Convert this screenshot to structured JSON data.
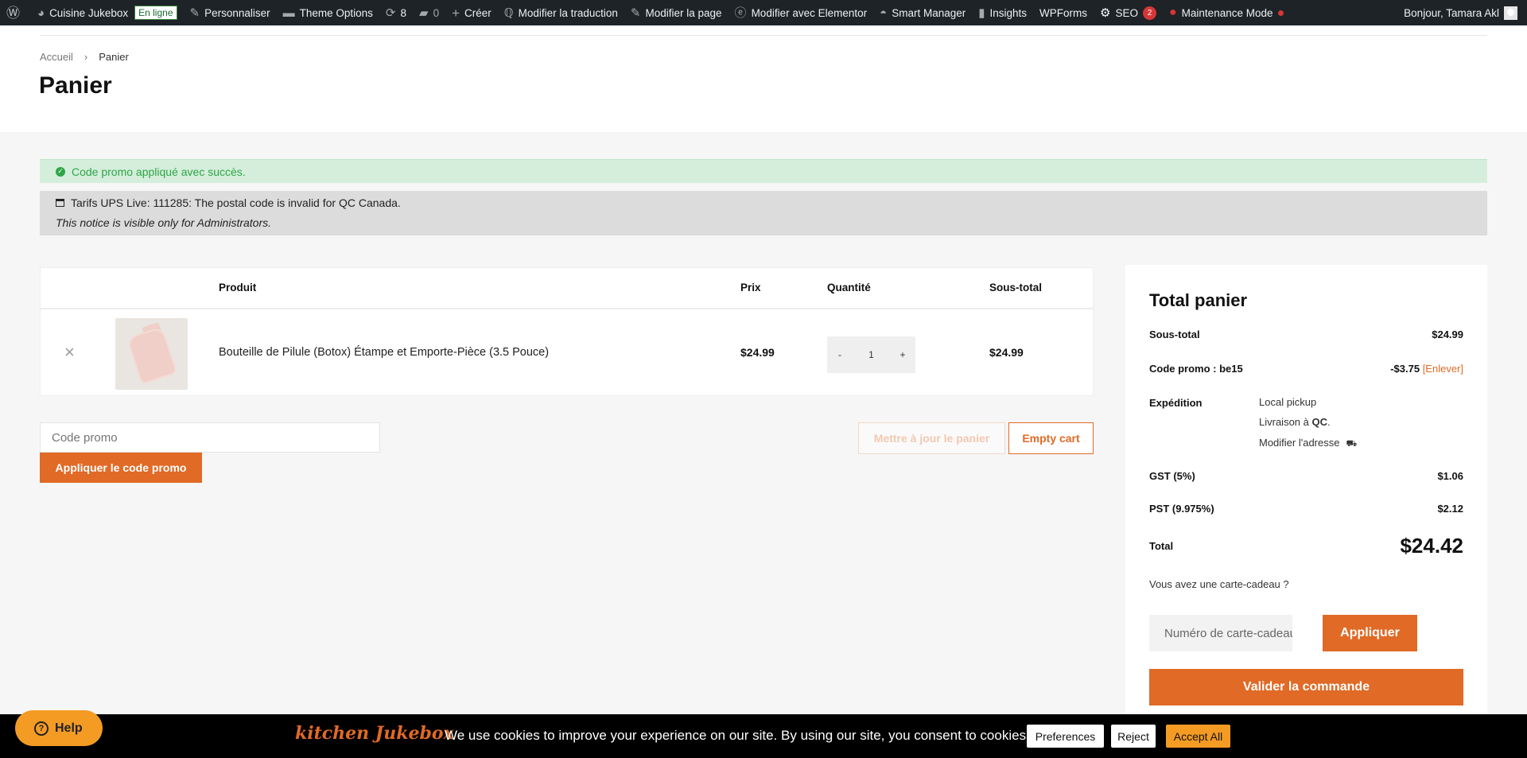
{
  "admin_bar": {
    "site_name": "Cuisine Jukebox",
    "site_status": "En ligne",
    "customize": "Personnaliser",
    "theme_options": "Theme Options",
    "updates_count": "8",
    "comments_count": "0",
    "new": "Créer",
    "edit_translation": "Modifier la traduction",
    "edit_page": "Modifier la page",
    "edit_elementor": "Modifier avec Elementor",
    "smart_manager": "Smart Manager",
    "insights": "Insights",
    "wpforms": "WPForms",
    "seo": "SEO",
    "seo_count": "2",
    "maintenance": "Maintenance Mode",
    "greeting": "Bonjour, Tamara Akl"
  },
  "breadcrumb": {
    "home": "Accueil",
    "current": "Panier"
  },
  "page_title": "Panier",
  "notices": {
    "success": "Code promo appliqué avec succès.",
    "info_line1": "Tarifs UPS Live: 111285: The postal code is invalid for QC Canada.",
    "info_line2": "This notice is visible only for Administrators."
  },
  "cart": {
    "headers": {
      "product": "Produit",
      "price": "Prix",
      "quantity": "Quantité",
      "subtotal": "Sous-total"
    },
    "items": [
      {
        "name": "Bouteille de Pilule (Botox) Étampe et Emporte-Pièce (3.5 Pouce)",
        "price": "$24.99",
        "qty": "1",
        "subtotal": "$24.99",
        "remove": "×",
        "minus": "-",
        "plus": "+"
      }
    ],
    "coupon_placeholder": "Code promo",
    "apply_coupon": "Appliquer le code promo",
    "update_cart": "Mettre à jour le panier",
    "empty_cart": "Empty cart"
  },
  "totals": {
    "title": "Total panier",
    "subtotal_label": "Sous-total",
    "subtotal_value": "$24.99",
    "promo_label": "Code promo : be15",
    "promo_value": "-$3.75",
    "promo_remove": "[Enlever]",
    "shipping_label": "Expédition",
    "shipping_method": "Local pickup",
    "shipping_dest_prefix": "Livraison à ",
    "shipping_dest_region": "QC",
    "shipping_dest_suffix": ".",
    "change_address": "Modifier l'adresse",
    "gst_label": "GST (5%)",
    "gst_value": "$1.06",
    "pst_label": "PST (9.975%)",
    "pst_value": "$2.12",
    "total_label": "Total",
    "total_value": "$24.42",
    "gift_question": "Vous avez une carte-cadeau ?",
    "gift_placeholder": "Numéro de carte-cadeau",
    "gift_apply": "Appliquer",
    "checkout": "Valider la commande"
  },
  "cookie": {
    "logo": "kitchen Jukebox",
    "text": "We use cookies to improve your experience on our site. By using our site, you consent to cookies.",
    "preferences": "Preferences",
    "reject": "Reject",
    "accept": "Accept All"
  },
  "help": {
    "label": "Help"
  },
  "colors": {
    "accent": "#e06a26",
    "cookie_accept": "#f49b24",
    "success_bg": "#d4eedb",
    "admin_bar": "#1d2327"
  },
  "icons": [
    "wordpress-icon",
    "dashboard-icon",
    "brush-icon",
    "folder-icon",
    "updates-icon",
    "comment-icon",
    "plus-icon",
    "translate-icon",
    "pencil-icon",
    "elementor-icon",
    "gauge-icon",
    "bar-chart-icon",
    "seo-gear-icon",
    "maintenance-icon",
    "check-circle-icon",
    "calendar-icon",
    "truck-icon",
    "question-icon"
  ]
}
